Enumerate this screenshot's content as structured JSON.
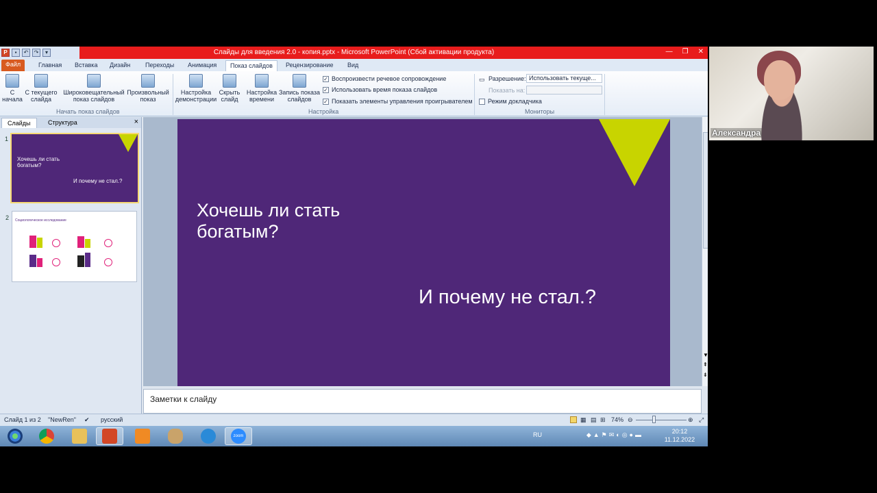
{
  "window": {
    "title": "Слайды для введения 2.0 - копия.pptx - Microsoft PowerPoint (Сбой активации продукта)",
    "min": "—",
    "max": "❐",
    "close": "✕"
  },
  "tabs": [
    "Файл",
    "Главная",
    "Вставка",
    "Дизайн",
    "Переходы",
    "Анимация",
    "Показ слайдов",
    "Рецензирование",
    "Вид"
  ],
  "ribbon": {
    "btn_from_start": "С начала",
    "btn_from_current": "С текущего слайда",
    "btn_broadcast": "Широковещательный показ слайдов",
    "btn_custom": "Произвольный показ",
    "group_start": "Начать показ слайдов",
    "btn_setup": "Настройка демонстрации",
    "btn_hide": "Скрыть слайд",
    "btn_timing": "Настройка времени",
    "btn_record": "Запись показа слайдов",
    "chk_narration": "Воспроизвести речевое сопровождение",
    "chk_timings": "Использовать время показа слайдов",
    "chk_controls": "Показать элементы управления проигрывателем",
    "group_setup": "Настройка",
    "resolution_label": "Разрешение:",
    "resolution_value": "Использовать текуще...",
    "show_on_label": "Показать на:",
    "presenter_view": "Режим докладчика",
    "group_monitors": "Мониторы"
  },
  "leftpane": {
    "tab_slides": "Слайды",
    "tab_outline": "Структура",
    "close": "×",
    "thumb1_num": "1",
    "thumb1_title": "Хочешь ли стать богатым?",
    "thumb1_sub": "И почему не стал.?",
    "thumb2_num": "2",
    "thumb2_title": "Социологическое исследование"
  },
  "slide": {
    "title": "Хочешь ли стать богатым?",
    "subtitle": "И почему не стал.?"
  },
  "notes": {
    "placeholder": "Заметки к слайду"
  },
  "status": {
    "slide_info": "Слайд 1 из 2",
    "theme": "\"NewRen\"",
    "language": "русский",
    "zoom": "74%"
  },
  "tray": {
    "lang": "RU",
    "time": "20:12",
    "date": "11.12.2022"
  },
  "taskbar": {
    "zoom_label": "zoom"
  },
  "video": {
    "name": "Александра"
  },
  "colors": {
    "slide_bg": "#4f2778",
    "accent": "#c8d400",
    "titlebar": "#e81c1c"
  }
}
